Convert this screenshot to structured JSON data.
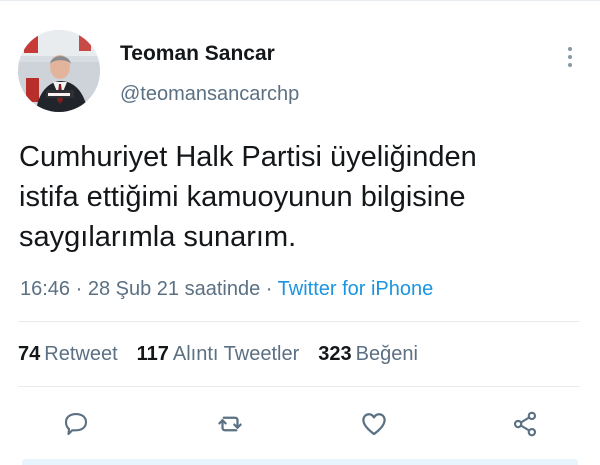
{
  "tweet": {
    "author": {
      "display_name": "Teoman Sancar",
      "username": "@teomansancarchp",
      "avatar_icon": "profile-photo"
    },
    "text": "Cumhuriyet Halk Partisi üyeliğinden\nistifa ettiğimi kamuoyunun bilgisine\nsaygılarımla sunarım.",
    "meta": {
      "time": "16:46",
      "separator": " · ",
      "date": "28 Şub 21 saatinde",
      "source": "Twitter for iPhone"
    },
    "stats": {
      "retweets": {
        "value": "74",
        "label": "Retweet"
      },
      "quote_tweets": {
        "value": "117",
        "label": "Alıntı Tweetler"
      },
      "likes": {
        "value": "323",
        "label": "Beğeni"
      }
    },
    "actions": [
      {
        "name": "reply",
        "icon": "speech-bubble-icon"
      },
      {
        "name": "retweet",
        "icon": "retweet-icon"
      },
      {
        "name": "like",
        "icon": "heart-icon"
      },
      {
        "name": "share",
        "icon": "share-icon"
      }
    ]
  },
  "colors": {
    "text_primary": "#14171a",
    "text_secondary": "#5b7083",
    "link": "#1b95e0",
    "icon_gray": "#5b7083",
    "divider": "#e6ecf0"
  }
}
